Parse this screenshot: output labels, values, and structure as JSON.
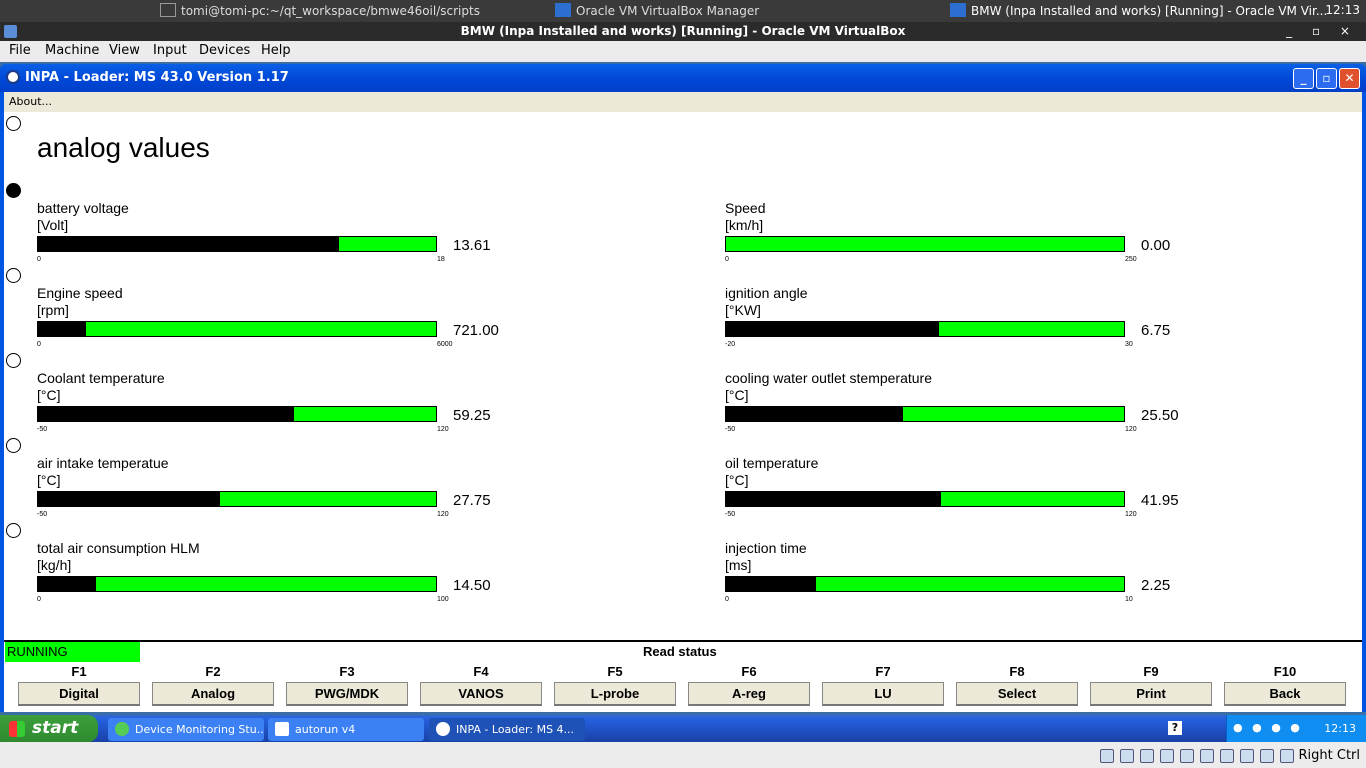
{
  "host": {
    "terminal": "tomi@tomi-pc:~/qt_workspace/bmwe46oil/scripts",
    "vbox_manager": "Oracle VM VirtualBox Manager",
    "vbox_window": "BMW (Inpa Installed and works) [Running] - Oracle VM Vir...",
    "clock": "12:13"
  },
  "vbox": {
    "title": "BMW (Inpa Installed and works) [Running] - Oracle VM VirtualBox",
    "menu": [
      "File",
      "Machine",
      "View",
      "Input",
      "Devices",
      "Help"
    ],
    "status_right": "Right Ctrl"
  },
  "inpa": {
    "title": "INPA - Loader:  MS 43.0 Version 1.17",
    "about": "About...",
    "heading": "analog values",
    "gauges": [
      {
        "label": "battery voltage",
        "unit": "[Volt]",
        "min": "0",
        "max": "18",
        "value": "13.61",
        "fraction": 0.756
      },
      {
        "label": "Speed",
        "unit": "[km/h]",
        "min": "0",
        "max": "250",
        "value": "0.00",
        "fraction": 0
      },
      {
        "label": "Engine speed",
        "unit": "[rpm]",
        "min": "0",
        "max": "6000",
        "value": "721.00",
        "fraction": 0.12
      },
      {
        "label": "ignition angle",
        "unit": "[°KW]",
        "min": "-20",
        "max": "30",
        "value": "6.75",
        "fraction": 0.535
      },
      {
        "label": "Coolant temperature",
        "unit": "[°C]",
        "min": "-50",
        "max": "120",
        "value": "59.25",
        "fraction": 0.643
      },
      {
        "label": "cooling water outlet stemperature",
        "unit": "[°C]",
        "min": "-50",
        "max": "120",
        "value": "25.50",
        "fraction": 0.444
      },
      {
        "label": "air intake temperatue",
        "unit": "[°C]",
        "min": "-50",
        "max": "120",
        "value": "27.75",
        "fraction": 0.457
      },
      {
        "label": "oil temperature",
        "unit": "[°C]",
        "min": "-50",
        "max": "120",
        "value": "41.95",
        "fraction": 0.541
      },
      {
        "label": "total air consumption HLM",
        "unit": "[kg/h]",
        "min": "0",
        "max": "100",
        "value": "14.50",
        "fraction": 0.145
      },
      {
        "label": "injection time",
        "unit": "[ms]",
        "min": "0",
        "max": "10",
        "value": "2.25",
        "fraction": 0.225
      }
    ],
    "status": "RUNNING",
    "read_status": "Read status",
    "fkeys": [
      {
        "key": "F1",
        "label": "Digital"
      },
      {
        "key": "F2",
        "label": "Analog"
      },
      {
        "key": "F3",
        "label": "PWG/MDK"
      },
      {
        "key": "F4",
        "label": "VANOS"
      },
      {
        "key": "F5",
        "label": "L-probe"
      },
      {
        "key": "F6",
        "label": "A-reg"
      },
      {
        "key": "F7",
        "label": "LU"
      },
      {
        "key": "F8",
        "label": "Select"
      },
      {
        "key": "F9",
        "label": "Print"
      },
      {
        "key": "F10",
        "label": "Back"
      }
    ]
  },
  "xp": {
    "start": "start",
    "tasks": [
      "Device Monitoring Stu...",
      "autorun v4",
      "INPA - Loader:  MS 4..."
    ],
    "clock": "12:13"
  }
}
